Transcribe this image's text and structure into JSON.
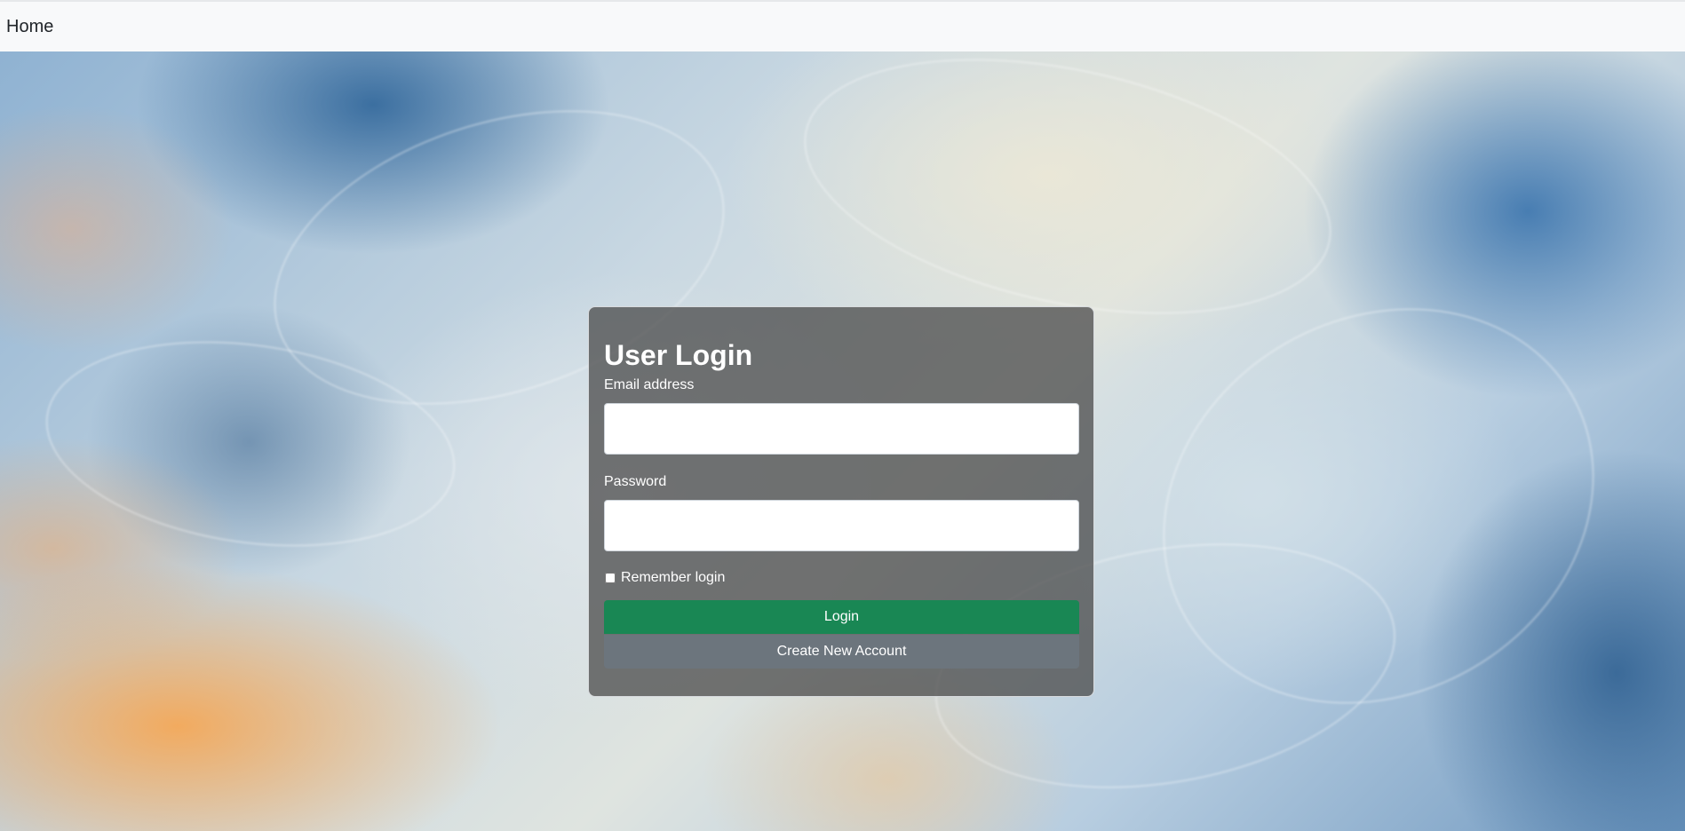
{
  "nav": {
    "home_label": "Home"
  },
  "login_card": {
    "title": "User Login",
    "email_label": "Email address",
    "email_value": "",
    "password_label": "Password",
    "password_value": "",
    "remember_label": "Remember login",
    "remember_checked": false,
    "login_button": "Login",
    "create_account_button": "Create New Account"
  },
  "colors": {
    "navbar_bg": "#f8f9fa",
    "card_bg": "rgba(72,72,72,0.74)",
    "login_button": "#198754",
    "create_button": "#6c757d"
  }
}
